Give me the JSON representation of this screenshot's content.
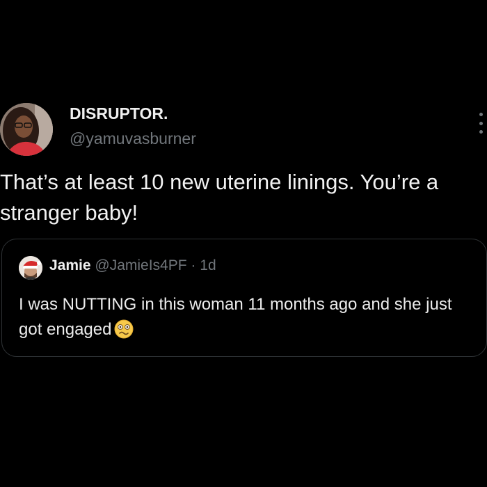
{
  "tweet": {
    "author": {
      "name": "DISRUPTOR.",
      "handle": "@yamuvasburner",
      "avatar_icon": "profile-photo-woman-with-glasses"
    },
    "text": "That’s at least 10 new uterine linings. You’re a stranger baby!",
    "more_icon": "more-vertical-icon",
    "quoted": {
      "author": {
        "name": "Jamie",
        "handle": "@JamieIs4PF",
        "avatar_icon": "profile-photo-man-with-santa-hat"
      },
      "separator": "·",
      "time": "1d",
      "text": "I was NUTTING in this woman 11 months ago and she just got engaged",
      "emoji": "woozy-face-emoji"
    }
  },
  "colors": {
    "background": "#000000",
    "text_primary": "#e7e9ea",
    "text_secondary": "#71767b",
    "card_border": "#2f3336"
  }
}
